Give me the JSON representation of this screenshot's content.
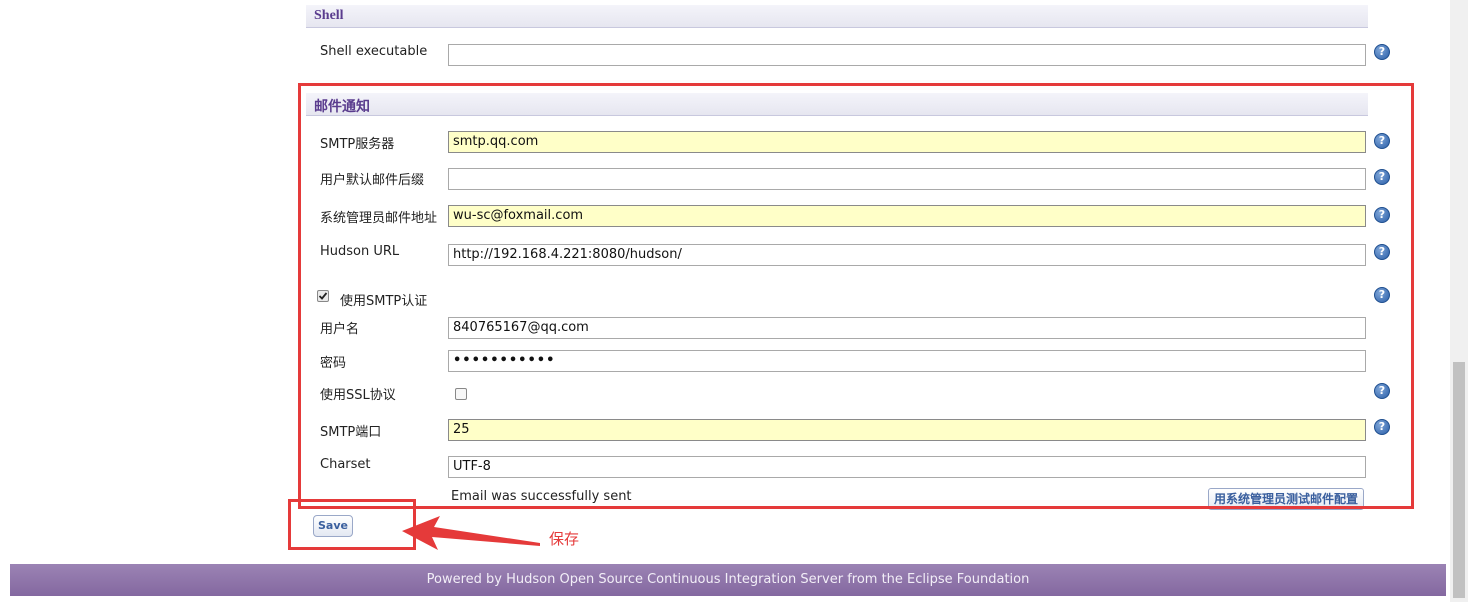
{
  "shell": {
    "section_title": "Shell",
    "executable_label": "Shell executable",
    "executable_value": ""
  },
  "mail": {
    "section_title": "邮件通知",
    "smtp_server_label": "SMTP服务器",
    "smtp_server_value": "smtp.qq.com",
    "default_suffix_label": "用户默认邮件后缀",
    "default_suffix_value": "",
    "admin_email_label": "系统管理员邮件地址",
    "admin_email_value": "wu-sc@foxmail.com",
    "hudson_url_label": "Hudson URL",
    "hudson_url_value": "http://192.168.4.221:8080/hudson/",
    "smtp_auth_label": "使用SMTP认证",
    "smtp_auth_checked": true,
    "username_label": "用户名",
    "username_value": "840765167@qq.com",
    "password_label": "密码",
    "password_value": "•••••••••••",
    "ssl_label": "使用SSL协议",
    "ssl_checked": false,
    "smtp_port_label": "SMTP端口",
    "smtp_port_value": "25",
    "charset_label": "Charset",
    "charset_value": "UTF-8",
    "status_message": "Email was successfully sent",
    "test_button_label": "用系统管理员测试邮件配置"
  },
  "save_button_label": "Save",
  "annotation_label": "保存",
  "footer_text": "Powered by Hudson Open Source Continuous Integration Server from the Eclipse Foundation",
  "colors": {
    "highlight_field": "#ffffc8",
    "annotation_red": "#e53a3a",
    "footer_purple": "#8e76a8",
    "section_title": "#5a3c8e"
  }
}
